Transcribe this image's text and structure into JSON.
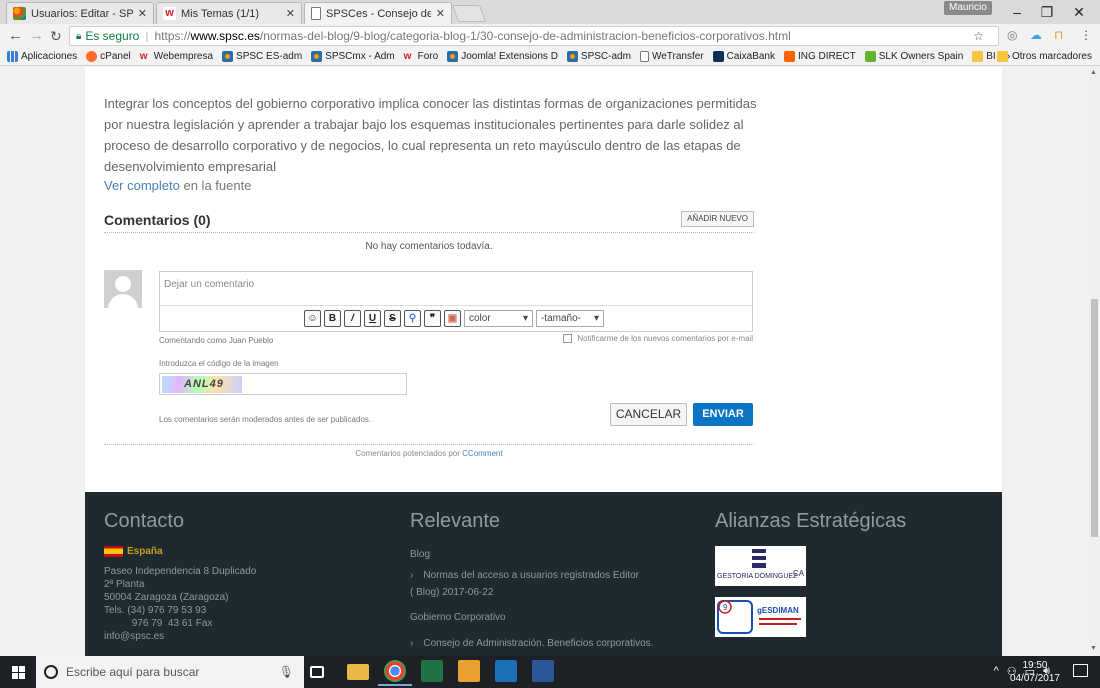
{
  "browser": {
    "tabs": [
      {
        "title": "Usuarios: Editar - SPSCes"
      },
      {
        "title": "Mis Temas (1/1)"
      },
      {
        "title": "SPSCes - Consejo de Adm"
      }
    ],
    "user_badge": "Mauricio",
    "secure_label": "Es seguro",
    "url_scheme": "https://",
    "url_host": "www.spsc.es",
    "url_path": "/normas-del-blog/9-blog/categoria-blog-1/30-consejo-de-administracion-beneficios-corporativos.html",
    "bookmarks": [
      {
        "label": "Aplicaciones",
        "icon": "apps"
      },
      {
        "label": "cPanel",
        "icon": "cpanel"
      },
      {
        "label": "Webempresa",
        "icon": "w"
      },
      {
        "label": "SPSC ES-adm",
        "icon": "joomla"
      },
      {
        "label": "SPSCmx - Adm",
        "icon": "joomla"
      },
      {
        "label": "Foro",
        "icon": "w"
      },
      {
        "label": "Joomla! Extensions D",
        "icon": "joomla"
      },
      {
        "label": "SPSC-adm",
        "icon": "joomla"
      },
      {
        "label": "WeTransfer",
        "icon": "doc"
      },
      {
        "label": "CaixaBank",
        "icon": "caixa"
      },
      {
        "label": "ING DIRECT",
        "icon": "ing"
      },
      {
        "label": "SLK Owners Spain",
        "icon": "slk"
      },
      {
        "label": "BI",
        "icon": "folder"
      }
    ],
    "bookmarks_more": "»",
    "other_bookmarks": "Otros marcadores"
  },
  "article": {
    "intro": "Integrar los conceptos del gobierno corporativo implica conocer las distintas formas de organizaciones permitidas por nuestra legislación y aprender a trabajar bajo los esquemas institucionales pertinentes para darle solidez al proceso de desarrollo corporativo y de negocios, lo cual representa un reto mayúsculo dentro de las etapas de desenvolvimiento empresarial",
    "source_link": "Ver completo",
    "source_rest": " en la fuente"
  },
  "comments": {
    "title": "Comentarios (0)",
    "add_new": "AÑADIR NUEVO",
    "empty": "No hay comentarios todavía.",
    "placeholder": "Dejar un comentario",
    "color_select": "color",
    "size_select": "-tamaño-",
    "commenting_as": "Comentando como Juan Pueblo",
    "notify": "Notificarme de los nuevos comentarios por e-mail",
    "captcha_label": "Introduzca el código de la imagen",
    "captcha_text": "ANL49",
    "moderated": "Los comentarios serán moderados antes de ser publicados.",
    "cancel": "CANCELAR",
    "send": "ENVIAR",
    "powered_prefix": "Comentarios potenciados por ",
    "powered_link": "CComment"
  },
  "footer": {
    "contact_title": "Contacto",
    "country": "España",
    "address": "Paseo Independencia 8 Duplicado\n2ª Planta\n50004 Zaragoza (Zaragoza)\nTels. (34) 976 79 53 93\n          976 79  43 61 Fax\ninfo@spsc.es",
    "relevant_title": "Relevante",
    "blog": "Blog",
    "blog_link": "Normas del acceso a usuarios registrados Editor",
    "blog_date": "(    Blog) 2017-06-22",
    "gobierno": "Gobierno Corporativo",
    "gobierno_link": "Consejo de Administración. Beneficios corporativos.",
    "alliances_title": "Alianzas Estratégicas",
    "logo1_text": "GESTORIA DOMINGUEZ",
    "logo2_text": "gESDIMAN"
  },
  "taskbar": {
    "search_placeholder": "Escribe aquí para buscar",
    "time": "19:50",
    "date": "04/07/2017"
  }
}
